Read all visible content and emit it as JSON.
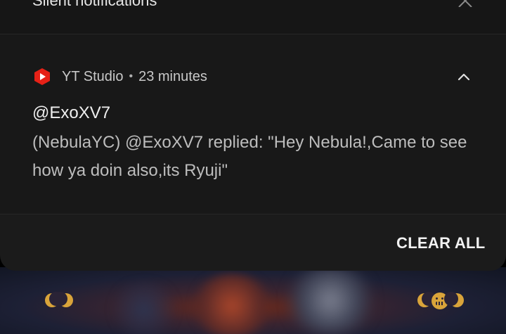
{
  "silent_section": {
    "title": "Silent notifications",
    "close_icon": "close-icon"
  },
  "notification": {
    "app_icon": "youtube-studio-icon",
    "app_name": "YT Studio",
    "separator": "•",
    "time": "23 minutes",
    "expand_icon": "chevron-up-icon",
    "title": "@ExoXV7",
    "body": "(NebulaYC) @ExoXV7 replied: \"Hey Nebula!,Came to see how ya doin also,its Ryuji\""
  },
  "actions": {
    "clear_all_label": "CLEAR ALL"
  },
  "colors": {
    "shade_background": "#1b1b1b",
    "app_icon_red": "#e62117",
    "text_primary": "#eeeeee",
    "text_secondary": "#bdbdbd"
  }
}
